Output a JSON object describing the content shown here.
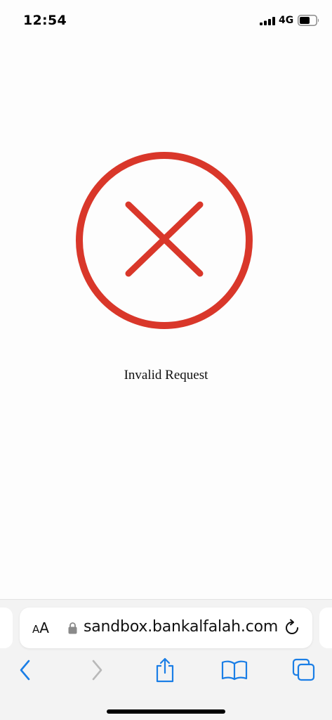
{
  "status": {
    "time": "12:54",
    "network": "4G",
    "signal_icon": "cellular-signal-icon",
    "battery_icon": "battery-icon"
  },
  "page": {
    "icon": "error-x-circle-icon",
    "icon_color": "#d9372a",
    "message": "Invalid Request"
  },
  "browser": {
    "reader_label_small": "A",
    "reader_label_large": "A",
    "url": "sandbox.bankalfalah.com",
    "accent_color": "#1a7ee6",
    "toolbar_icons": [
      "back-icon",
      "forward-icon",
      "share-icon",
      "bookmarks-icon",
      "tabs-icon"
    ]
  }
}
